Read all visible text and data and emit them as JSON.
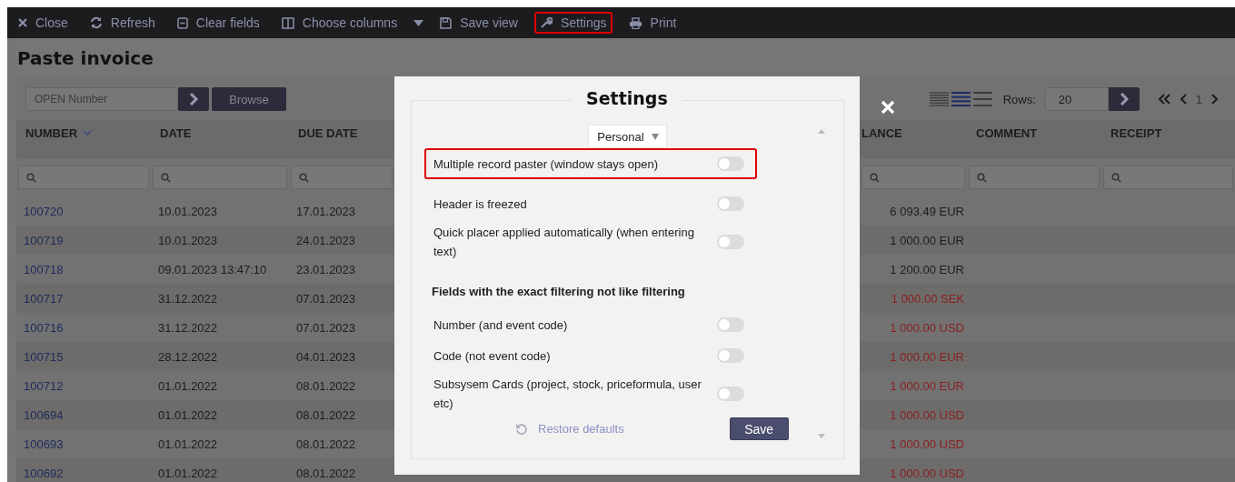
{
  "toolbar": [
    {
      "kind": "close",
      "label": "Close",
      "highlighted": false
    },
    {
      "kind": "refresh",
      "label": "Refresh",
      "highlighted": false
    },
    {
      "kind": "clear",
      "label": "Clear fields",
      "highlighted": false
    },
    {
      "kind": "columns",
      "label": "Choose columns",
      "highlighted": false
    },
    {
      "kind": "caret"
    },
    {
      "kind": "save",
      "label": "Save view",
      "highlighted": false
    },
    {
      "kind": "settings",
      "label": "Settings",
      "highlighted": true
    },
    {
      "kind": "print",
      "label": "Print",
      "highlighted": false
    }
  ],
  "page_title": "Paste invoice",
  "search": {
    "placeholder": "OPEN Number",
    "browse": "Browse"
  },
  "view_modes": [
    {
      "selected": false
    },
    {
      "selected": true
    },
    {
      "selected": false
    }
  ],
  "rows_label": "Rows:",
  "rows_value": "20",
  "page": "1",
  "table": {
    "columns": [
      {
        "label": "NUMBER",
        "sorted": true
      },
      {
        "label": "DATE",
        "sorted": false
      },
      {
        "label": "DUE DATE",
        "sorted": false
      },
      {
        "label": "LANCE",
        "sorted": false
      },
      {
        "label": "COMMENT",
        "sorted": false
      },
      {
        "label": "RECEIPT",
        "sorted": false
      }
    ],
    "rows": [
      {
        "number": "100720",
        "date": "10.01.2023",
        "due_date": "17.01.2023",
        "balance": "6 093.49 EUR",
        "color": "#1c1c1c"
      },
      {
        "number": "100719",
        "date": "10.01.2023",
        "due_date": "24.01.2023",
        "balance": "1 000.00 EUR",
        "color": "#1c1c1c"
      },
      {
        "number": "100718",
        "date": "09.01.2023 13:47:10",
        "due_date": "23.01.2023",
        "balance": "1 200.00 EUR",
        "color": "#1c1c1c"
      },
      {
        "number": "100717",
        "date": "31.12.2022",
        "due_date": "07.01.2023",
        "balance": "1 000.00 SEK",
        "color": "#8a1e1e"
      },
      {
        "number": "100716",
        "date": "31.12.2022",
        "due_date": "07.01.2023",
        "balance": "1 000.00 USD",
        "color": "#8a1e1e"
      },
      {
        "number": "100715",
        "date": "28.12.2022",
        "due_date": "04.01.2023",
        "balance": "1 000.00 EUR",
        "color": "#8a1e1e"
      },
      {
        "number": "100712",
        "date": "01.01.2022",
        "due_date": "08.01.2022",
        "balance": "1 000.00 EUR",
        "color": "#8a1e1e"
      },
      {
        "number": "100694",
        "date": "01.01.2022",
        "due_date": "08.01.2022",
        "balance": "1 000.00 USD",
        "color": "#8a1e1e"
      },
      {
        "number": "100693",
        "date": "01.01.2022",
        "due_date": "08.01.2022",
        "balance": "1 000.00 USD",
        "color": "#8a1e1e"
      },
      {
        "number": "100692",
        "date": "01.01.2022",
        "due_date": "08.01.2022",
        "balance": "1 000.00 USD",
        "color": "#8a1e1e"
      }
    ]
  },
  "dialog": {
    "title": "Settings",
    "scope": "Personal",
    "options": [
      {
        "kind": "toggle",
        "label": "Multiple record paster (window stays open)",
        "on": false,
        "highlighted": true
      },
      {
        "kind": "toggle",
        "label": "Header is freezed",
        "on": false,
        "highlighted": false
      },
      {
        "kind": "toggle",
        "label": "Quick placer applied automatically (when entering text)",
        "on": false,
        "highlighted": false
      },
      {
        "kind": "heading",
        "label": "Fields with the exact filtering not like filtering"
      },
      {
        "kind": "toggle",
        "label": "Number (and event code)",
        "on": false,
        "highlighted": false
      },
      {
        "kind": "toggle",
        "label": "Code (not event code)",
        "on": false,
        "highlighted": false
      },
      {
        "kind": "toggle",
        "label": "Subsysem Cards (project, stock, priceformula, user etc)",
        "on": false,
        "highlighted": false
      }
    ],
    "restore": "Restore defaults",
    "save": "Save"
  }
}
